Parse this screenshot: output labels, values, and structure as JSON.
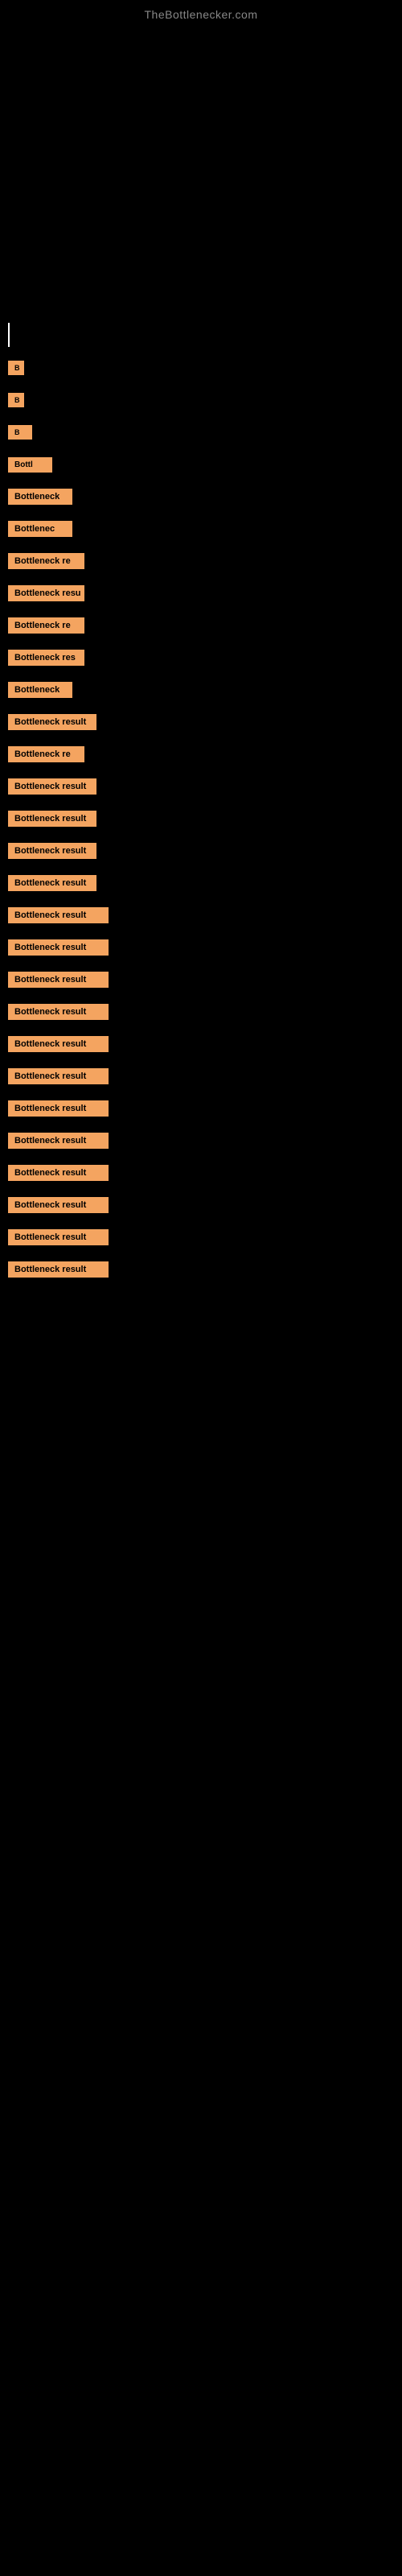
{
  "site": {
    "title": "TheBottlenecker.com"
  },
  "results": [
    {
      "id": 1,
      "label": "|",
      "size": "cursor"
    },
    {
      "id": 2,
      "label": "B",
      "size": "xs"
    },
    {
      "id": 3,
      "label": "B",
      "size": "xs"
    },
    {
      "id": 4,
      "label": "B",
      "size": "sm"
    },
    {
      "id": 5,
      "label": "Bottl",
      "size": "md"
    },
    {
      "id": 6,
      "label": "Bottleneck",
      "size": "lg"
    },
    {
      "id": 7,
      "label": "Bottlenec",
      "size": "lg"
    },
    {
      "id": 8,
      "label": "Bottleneck re",
      "size": "xl"
    },
    {
      "id": 9,
      "label": "Bottleneck resu",
      "size": "xl"
    },
    {
      "id": 10,
      "label": "Bottleneck re",
      "size": "xl"
    },
    {
      "id": 11,
      "label": "Bottleneck res",
      "size": "xl"
    },
    {
      "id": 12,
      "label": "Bottleneck",
      "size": "lg"
    },
    {
      "id": 13,
      "label": "Bottleneck result",
      "size": "xxl"
    },
    {
      "id": 14,
      "label": "Bottleneck re",
      "size": "xl"
    },
    {
      "id": 15,
      "label": "Bottleneck result",
      "size": "xxl"
    },
    {
      "id": 16,
      "label": "Bottleneck result",
      "size": "xxl"
    },
    {
      "id": 17,
      "label": "Bottleneck result",
      "size": "xxl"
    },
    {
      "id": 18,
      "label": "Bottleneck result",
      "size": "xxl"
    },
    {
      "id": 19,
      "label": "Bottleneck result",
      "size": "full"
    },
    {
      "id": 20,
      "label": "Bottleneck result",
      "size": "full"
    },
    {
      "id": 21,
      "label": "Bottleneck result",
      "size": "full"
    },
    {
      "id": 22,
      "label": "Bottleneck result",
      "size": "full"
    },
    {
      "id": 23,
      "label": "Bottleneck result",
      "size": "full"
    },
    {
      "id": 24,
      "label": "Bottleneck result",
      "size": "full"
    },
    {
      "id": 25,
      "label": "Bottleneck result",
      "size": "full"
    },
    {
      "id": 26,
      "label": "Bottleneck result",
      "size": "full"
    },
    {
      "id": 27,
      "label": "Bottleneck result",
      "size": "full"
    },
    {
      "id": 28,
      "label": "Bottleneck result",
      "size": "full"
    },
    {
      "id": 29,
      "label": "Bottleneck result",
      "size": "full"
    },
    {
      "id": 30,
      "label": "Bottleneck result",
      "size": "full"
    }
  ],
  "colors": {
    "background": "#000000",
    "badge_bg": "#f4a460",
    "badge_text": "#000000",
    "site_title": "#888888"
  }
}
